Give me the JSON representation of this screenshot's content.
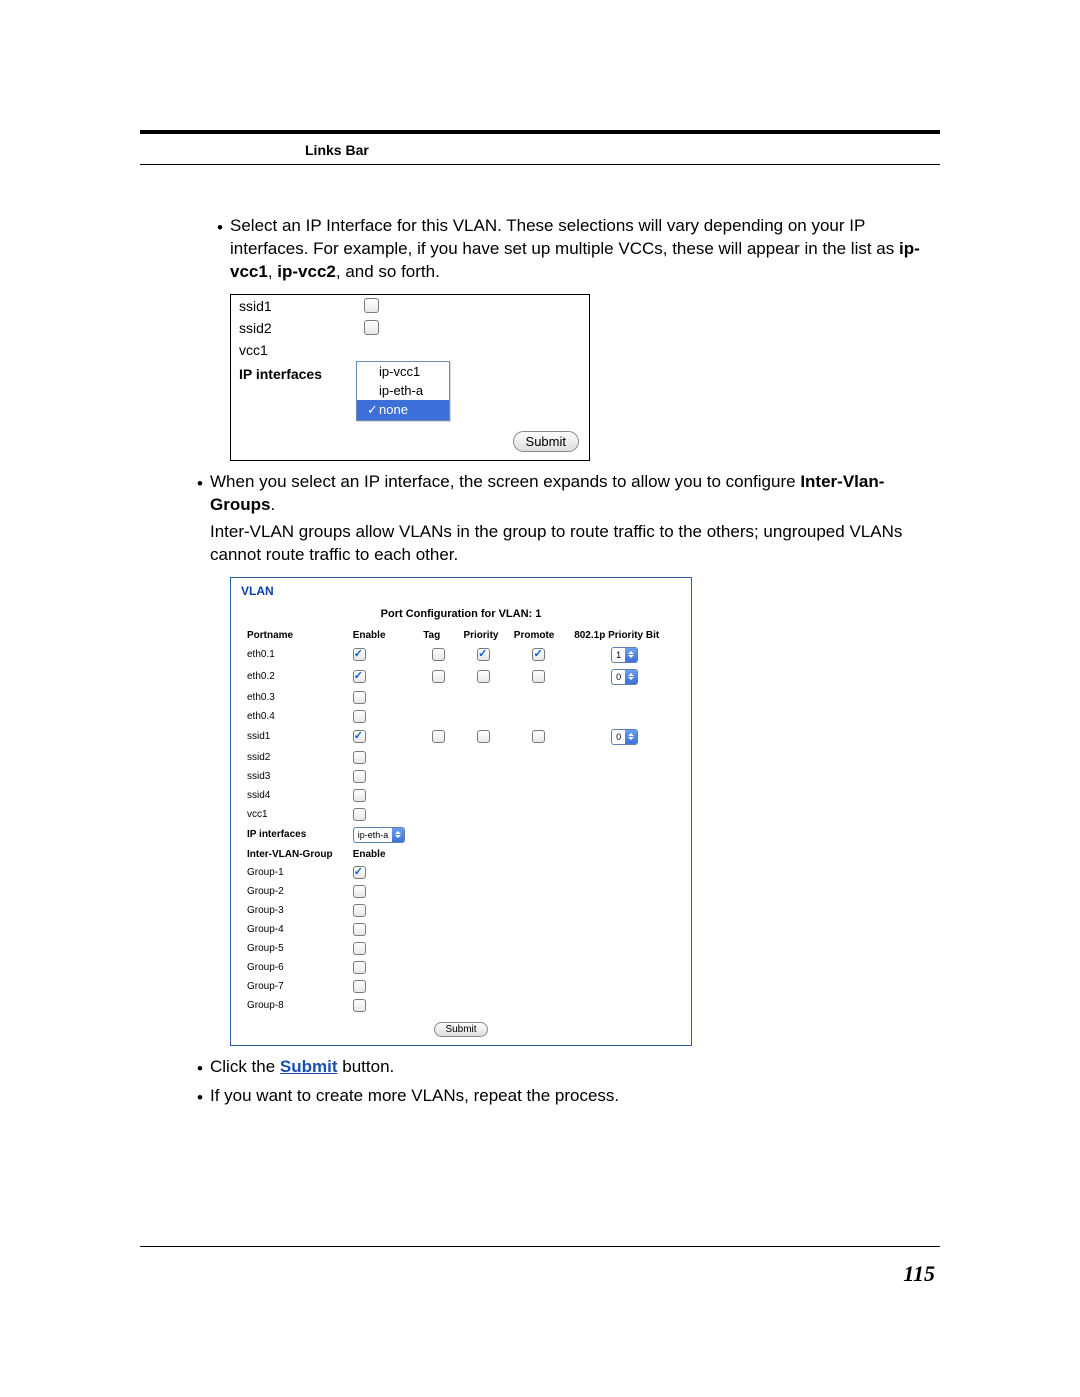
{
  "header": {
    "links_bar": "Links Bar"
  },
  "bullets": {
    "b1_pre": "Select an IP Interface for this VLAN. These selections will vary depending on your IP interfaces. For example, if you have set up multiple VCCs, these will appear in the list as ",
    "b1_bold1": "ip-vcc1",
    "b1_sep": ", ",
    "b1_bold2": "ip-vcc2",
    "b1_post": ", and so forth.",
    "b2_pre": "When you select an IP interface, the screen expands to allow you to configure ",
    "b2_bold": "Inter-Vlan-Groups",
    "b2_post": ".",
    "b2_para2": "Inter-VLAN groups allow VLANs in the group to route traffic to the others; ungrouped VLANs cannot route traffic to each other.",
    "b3_pre": "Click the ",
    "b3_link": "Submit",
    "b3_post": " button.",
    "b4": "If you want to create more VLANs, repeat the process."
  },
  "shot1": {
    "rows": [
      "ssid1",
      "ssid2",
      "vcc1"
    ],
    "ip_label": "IP interfaces",
    "dropdown": {
      "options": [
        "ip-vcc1",
        "ip-eth-a",
        "none"
      ],
      "selected": "none"
    },
    "submit": "Submit"
  },
  "shot2": {
    "title": "VLAN",
    "caption": "Port Configuration for VLAN: 1",
    "headers": {
      "port": "Portname",
      "enable": "Enable",
      "tag": "Tag",
      "priority": "Priority",
      "promote": "Promote",
      "bit": "802.1p Priority Bit"
    },
    "ports": [
      {
        "name": "eth0.1",
        "enable": true,
        "tag": false,
        "priority": true,
        "promote": true,
        "bit": "1"
      },
      {
        "name": "eth0.2",
        "enable": true,
        "tag": false,
        "priority": false,
        "promote": false,
        "bit": "0"
      },
      {
        "name": "eth0.3",
        "enable": false
      },
      {
        "name": "eth0.4",
        "enable": false
      },
      {
        "name": "ssid1",
        "enable": true,
        "tag": false,
        "priority": false,
        "promote": false,
        "bit": "0"
      },
      {
        "name": "ssid2",
        "enable": false
      },
      {
        "name": "ssid3",
        "enable": false
      },
      {
        "name": "ssid4",
        "enable": false
      },
      {
        "name": "vcc1",
        "enable": false
      }
    ],
    "ip_label": "IP interfaces",
    "ip_value": "ip-eth-a",
    "group_header": {
      "name": "Inter-VLAN-Group",
      "enable": "Enable"
    },
    "groups": [
      {
        "name": "Group-1",
        "enable": true
      },
      {
        "name": "Group-2",
        "enable": false
      },
      {
        "name": "Group-3",
        "enable": false
      },
      {
        "name": "Group-4",
        "enable": false
      },
      {
        "name": "Group-5",
        "enable": false
      },
      {
        "name": "Group-6",
        "enable": false
      },
      {
        "name": "Group-7",
        "enable": false
      },
      {
        "name": "Group-8",
        "enable": false
      }
    ],
    "submit": "Submit"
  },
  "page_number": "115"
}
